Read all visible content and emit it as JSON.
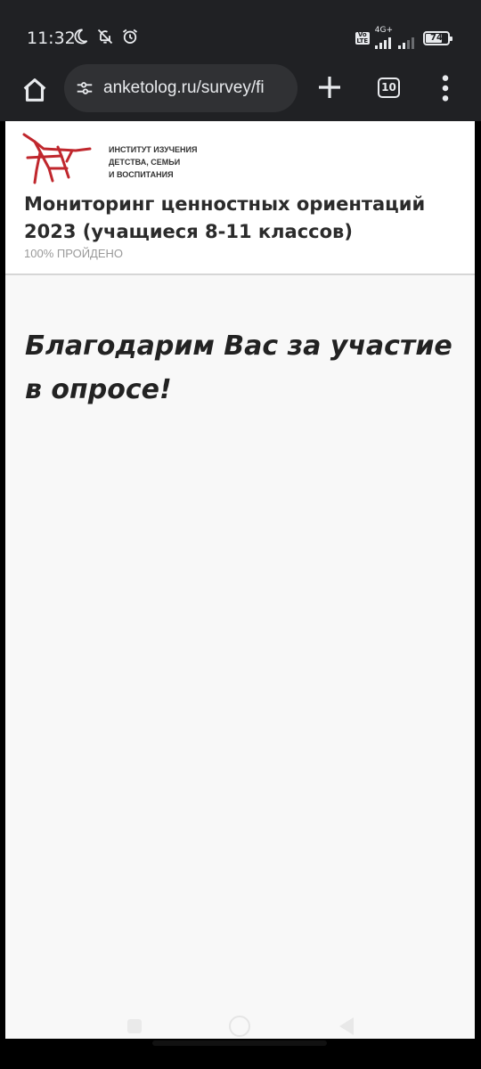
{
  "status_bar": {
    "time": "11:32",
    "volte_label": "Vo LTE",
    "network_type": "4G+",
    "battery_level": "74",
    "battery_fraction": 0.74,
    "icons": [
      "moon-icon",
      "bell-off-icon",
      "alarm-icon",
      "signal-icon",
      "battery-icon"
    ]
  },
  "browser": {
    "url": "anketolog.ru/survey/fi",
    "tab_count": "10",
    "icons": [
      "home-icon",
      "site-info-icon",
      "plus-icon",
      "tabs-icon",
      "more-menu-icon"
    ]
  },
  "header": {
    "institute_name": [
      "ИНСТИТУТ ИЗУЧЕНИЯ",
      "ДЕТСТВА, СЕМЬИ",
      "И ВОСПИТАНИЯ"
    ],
    "survey_title": "Мониторинг ценностных ориентаций 2023 (учащиеся 8-11 классов)",
    "progress_text": "100% ПРОЙДЕНО",
    "brand_color": "#c0272d"
  },
  "main": {
    "thanks_message": "Благодарим Вас за участие в опросе!"
  },
  "colors": {
    "chrome_bg": "#202124",
    "url_pill_bg": "#303134",
    "page_bg": "#f8f8f8",
    "header_bg": "#ffffff"
  }
}
